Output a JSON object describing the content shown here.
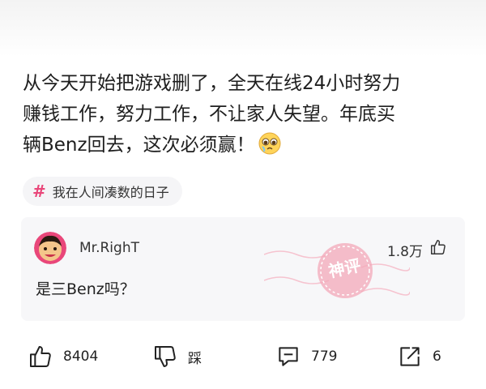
{
  "post": {
    "lines": [
      "从今天开始把游戏删了，全天在线24小时努力",
      "赚钱工作，努力工作，不让家人失望。年底买",
      "辆Benz回去，这次必须赢！"
    ],
    "emoji_icon": "pleading-face-icon"
  },
  "tag": {
    "symbol": "#",
    "label": "我在人间凑数的日子"
  },
  "hot_comment": {
    "username": "Mr.RighT",
    "likes": "1.8万",
    "text": "是三Benz吗？",
    "stamp": "神评"
  },
  "actions": {
    "like_count": "8404",
    "dislike_label": "踩",
    "comment_count": "779",
    "share_count": "6"
  },
  "colors": {
    "accent": "#e9477a",
    "stamp": "#f3a8b8"
  }
}
